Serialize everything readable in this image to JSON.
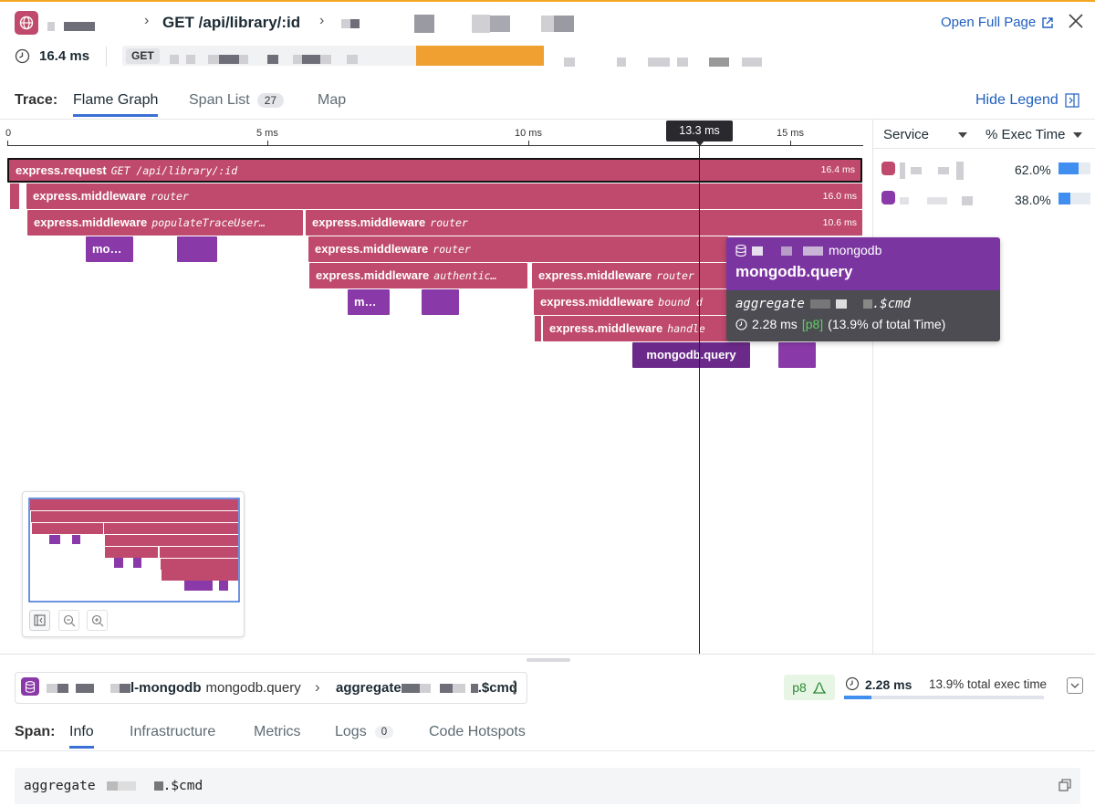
{
  "header": {
    "route": "GET /api/library/:id",
    "open_full_page": "Open Full Page",
    "duration": "16.4 ms",
    "method_badge": "GET"
  },
  "trace_tabs": {
    "label": "Trace:",
    "flame_graph": "Flame Graph",
    "span_list": "Span List",
    "span_list_count": "27",
    "map": "Map",
    "hide_legend": "Hide Legend"
  },
  "timeline": {
    "ticks": [
      "0",
      "5 ms",
      "10 ms",
      "15 ms"
    ],
    "cursor_label": "13.3 ms"
  },
  "legend": {
    "service_header": "Service",
    "exec_header": "% Exec Time",
    "rows": [
      {
        "color": "#bf4a6d",
        "percent": "62.0%",
        "fraction": 0.62
      },
      {
        "color": "#8a3aa8",
        "percent": "38.0%",
        "fraction": 0.38
      }
    ]
  },
  "flame": {
    "root": {
      "name": "express.request",
      "resource": "GET /api/library/:id",
      "dur": "16.4 ms"
    },
    "mw_router_1": {
      "name": "express.middleware",
      "resource": "router",
      "dur": "16.0 ms"
    },
    "mw_populate": {
      "name": "express.middleware",
      "resource": "populateTraceUser…"
    },
    "mw_router_2": {
      "name": "express.middleware",
      "resource": "router",
      "dur": "10.6 ms"
    },
    "mo_short": "mo…",
    "mw_router_3": {
      "name": "express.middleware",
      "resource": "router"
    },
    "mw_authentic": {
      "name": "express.middleware",
      "resource": "authentic…"
    },
    "mw_router_4": {
      "name": "express.middleware",
      "resource": "router"
    },
    "m_short": "m…",
    "mw_bound": {
      "name": "express.middleware",
      "resource": "bound d"
    },
    "mw_handle": {
      "name": "express.middleware",
      "resource": "handle"
    },
    "mongo_query": "mongodb.query"
  },
  "tooltip": {
    "service_suffix": "mongodb",
    "title": "mongodb.query",
    "resource_prefix": "aggregate",
    "resource_suffix": ".$cmd",
    "duration": "2.28 ms",
    "percentile": "[p8]",
    "share": "(13.9% of total Time)"
  },
  "span": {
    "service_suffix": "l-mongodb",
    "operation": "mongodb.query",
    "resource_prefix": "aggregate",
    "resource_suffix": ".$cmd",
    "percentile_badge": "p8",
    "duration": "2.28 ms",
    "exec_fraction": 0.139,
    "exec_share": "13.9% total exec time"
  },
  "span_tabs": {
    "label": "Span:",
    "info": "Info",
    "infrastructure": "Infrastructure",
    "metrics": "Metrics",
    "logs": "Logs",
    "logs_count": "0",
    "code_hotspots": "Code Hotspots"
  },
  "info": {
    "resource_prefix": "aggregate",
    "resource_suffix": ".$cmd"
  }
}
